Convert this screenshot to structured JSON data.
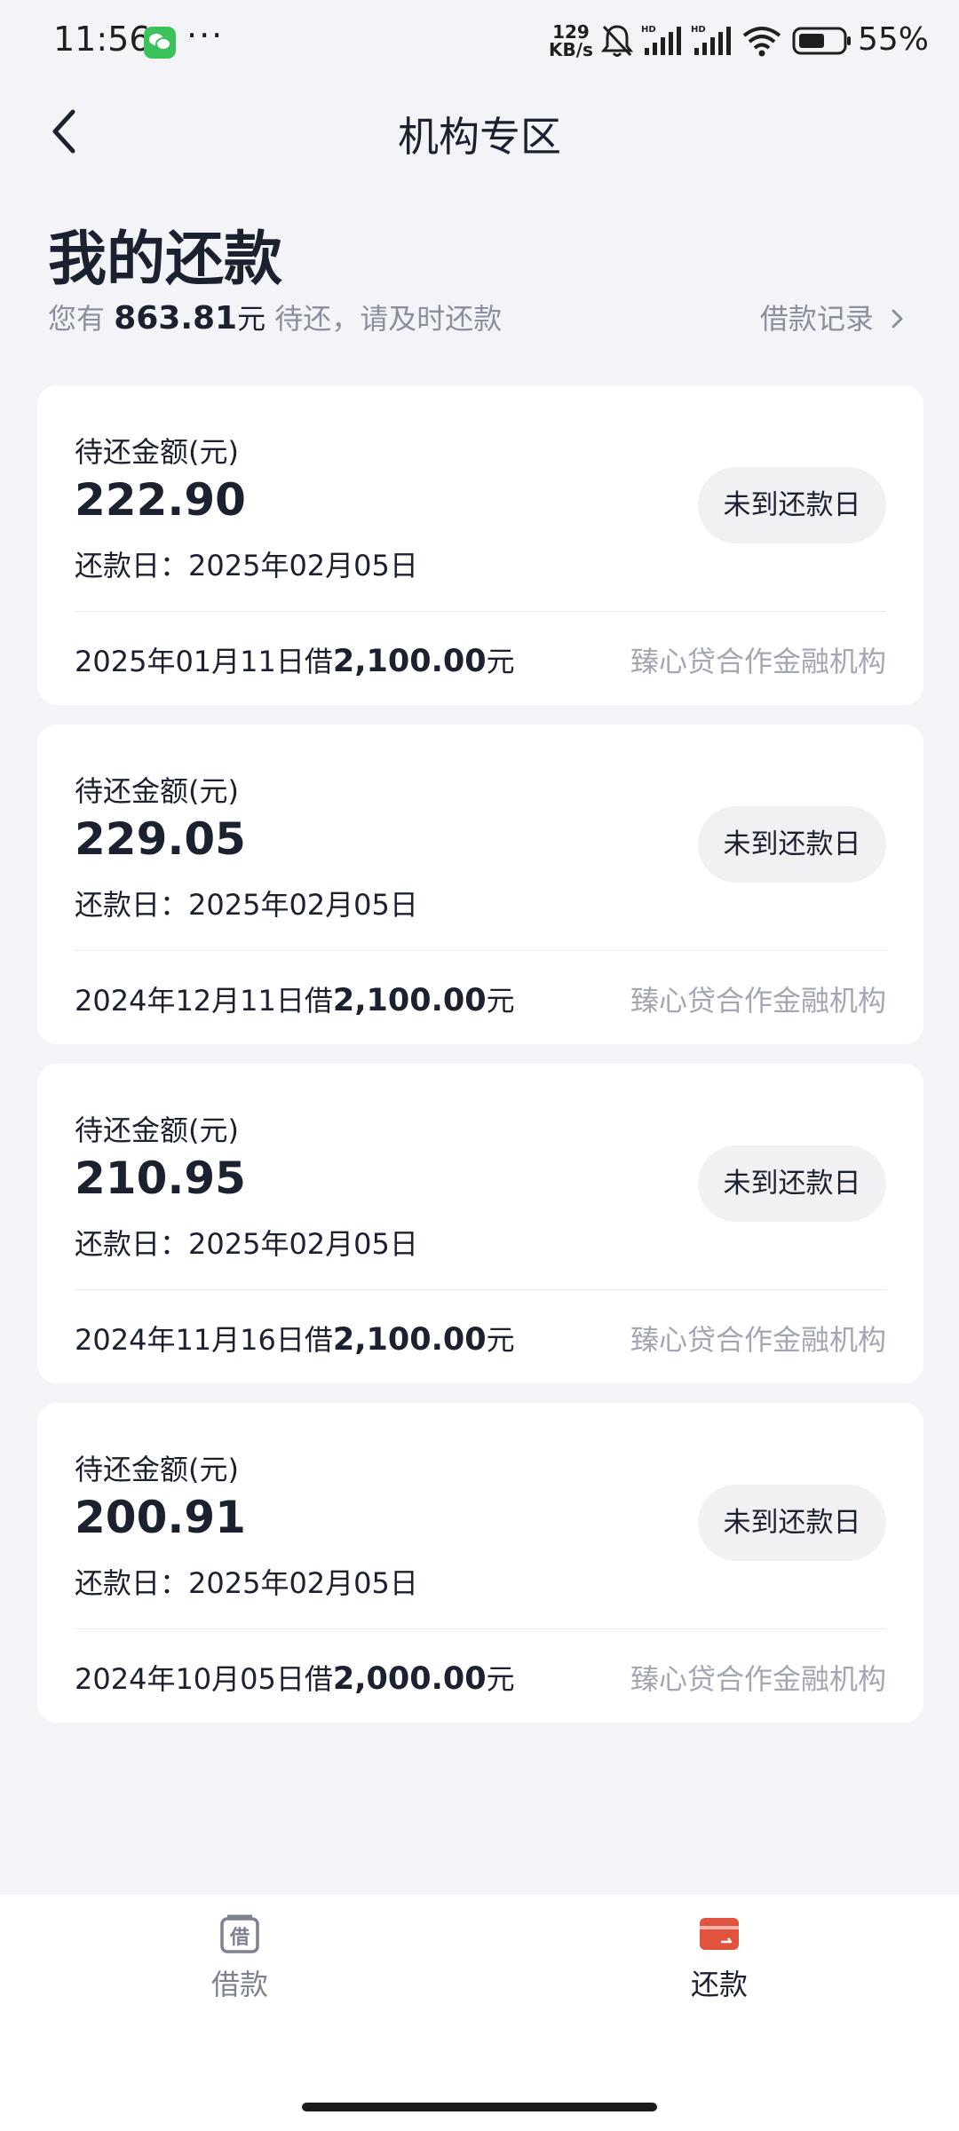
{
  "status_bar": {
    "time": "11:56",
    "net_speed_value": "129",
    "net_speed_unit": "KB/s",
    "battery_percent": "55%",
    "icons": [
      "wechat-icon",
      "more-icon",
      "mute-bell-icon",
      "hd-signal-icon",
      "hd-signal-icon",
      "wifi-icon",
      "battery-icon"
    ]
  },
  "header": {
    "title": "机构专区",
    "back_icon": "chevron-left-icon"
  },
  "section": {
    "title": "我的还款",
    "summary_prefix": "您有",
    "summary_amount": "863.81",
    "summary_unit": "元",
    "summary_suffix": " 待还，请及时还款",
    "loan_record_label": "借款记录",
    "loan_record_icon": "chevron-right-icon"
  },
  "cards": [
    {
      "label": "待还金额(元)",
      "amount": "222.90",
      "due": "还款日：2025年02月05日",
      "status": "未到还款日",
      "loan_date": "2025年01月11日借",
      "principal": "2,100.00",
      "principal_unit": "元",
      "institution": "臻心贷合作金融机构"
    },
    {
      "label": "待还金额(元)",
      "amount": "229.05",
      "due": "还款日：2025年02月05日",
      "status": "未到还款日",
      "loan_date": "2024年12月11日借",
      "principal": "2,100.00",
      "principal_unit": "元",
      "institution": "臻心贷合作金融机构"
    },
    {
      "label": "待还金额(元)",
      "amount": "210.95",
      "due": "还款日：2025年02月05日",
      "status": "未到还款日",
      "loan_date": "2024年11月16日借",
      "principal": "2,100.00",
      "principal_unit": "元",
      "institution": "臻心贷合作金融机构"
    },
    {
      "label": "待还金额(元)",
      "amount": "200.91",
      "due": "还款日：2025年02月05日",
      "status": "未到还款日",
      "loan_date": "2024年10月05日借",
      "principal": "2,000.00",
      "principal_unit": "元",
      "institution": "臻心贷合作金融机构"
    }
  ],
  "bottom_nav": {
    "items": [
      {
        "label": "借款",
        "icon": "borrow-icon",
        "active": false
      },
      {
        "label": "还款",
        "icon": "repay-card-icon",
        "active": true
      }
    ]
  },
  "colors": {
    "background": "#f3f4f8",
    "card": "#ffffff",
    "text_primary": "#1c2130",
    "text_secondary": "#8a8f9c",
    "text_muted": "#a3a7b2",
    "accent_red": "#e0543f",
    "nav_inactive": "#7d8290",
    "status_button_bg": "#f1f1f3"
  }
}
